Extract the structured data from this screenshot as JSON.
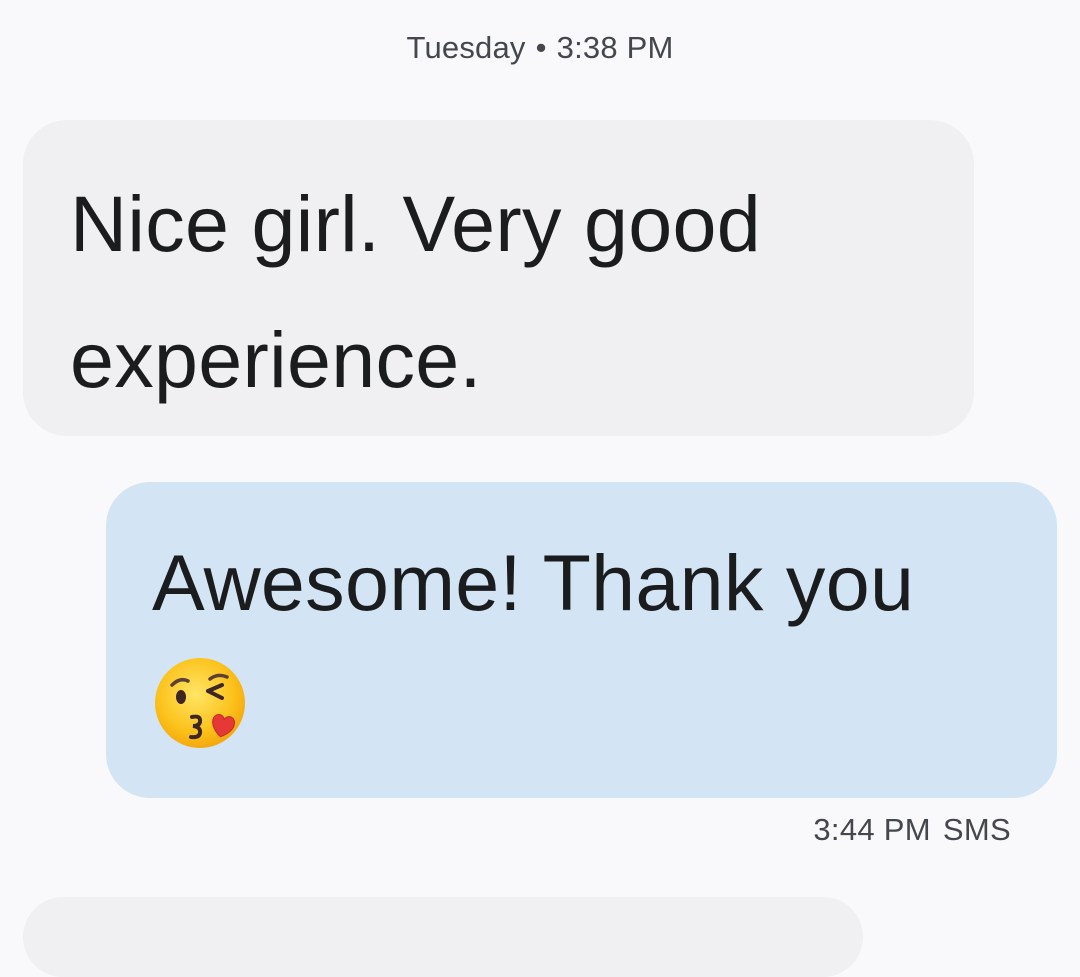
{
  "day_header": {
    "day": "Tuesday",
    "separator": "•",
    "time": "3:38 PM"
  },
  "messages": [
    {
      "direction": "incoming",
      "lines": [
        "Nice girl. Very good",
        "experience."
      ]
    },
    {
      "direction": "outgoing",
      "lines": [
        "Awesome! Thank you"
      ],
      "emoji": "face-blowing-a-kiss-icon",
      "time": "3:44 PM",
      "channel": "SMS"
    }
  ],
  "colors": {
    "background": "#f9f9fc",
    "incoming_bubble": "#f0f0f2",
    "outgoing_bubble": "#d3e4f5",
    "text": "#1b1c1e",
    "meta_text": "#44474c"
  }
}
